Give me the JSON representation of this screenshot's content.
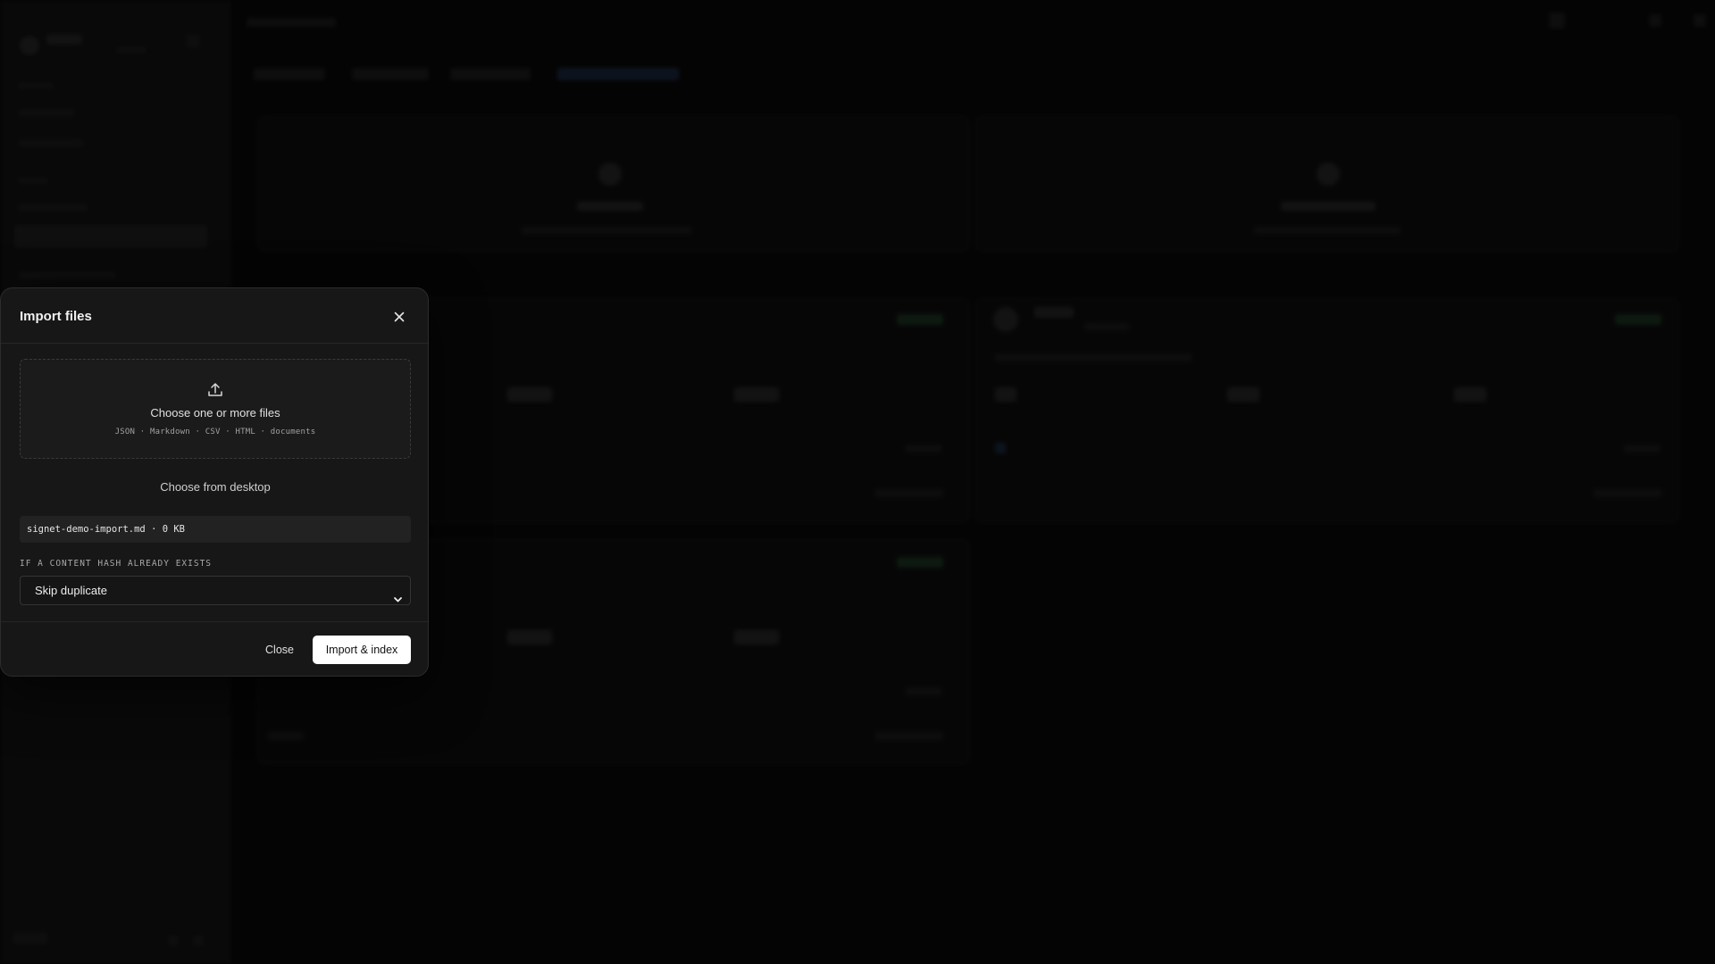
{
  "dialog": {
    "title": "Import files",
    "dropzone": {
      "title": "Choose one or more files",
      "types": "JSON · Markdown · CSV · HTML · documents"
    },
    "choose_desktop_label": "Choose from desktop",
    "selected_file": "signet-demo-import.md · 0 KB",
    "duplicate_policy": {
      "label": "IF A CONTENT HASH ALREADY EXISTS",
      "selected": "Skip duplicate"
    },
    "close_label": "Close",
    "import_label": "Import & index"
  },
  "icons": {
    "close": "close-icon",
    "upload": "upload-icon",
    "dropdown": "chevron-down-icon"
  },
  "colors": {
    "backdrop": "#0a0a0a",
    "modal_bg": "#171717",
    "primary_button_bg": "#ffffff",
    "primary_button_text": "#111111"
  }
}
